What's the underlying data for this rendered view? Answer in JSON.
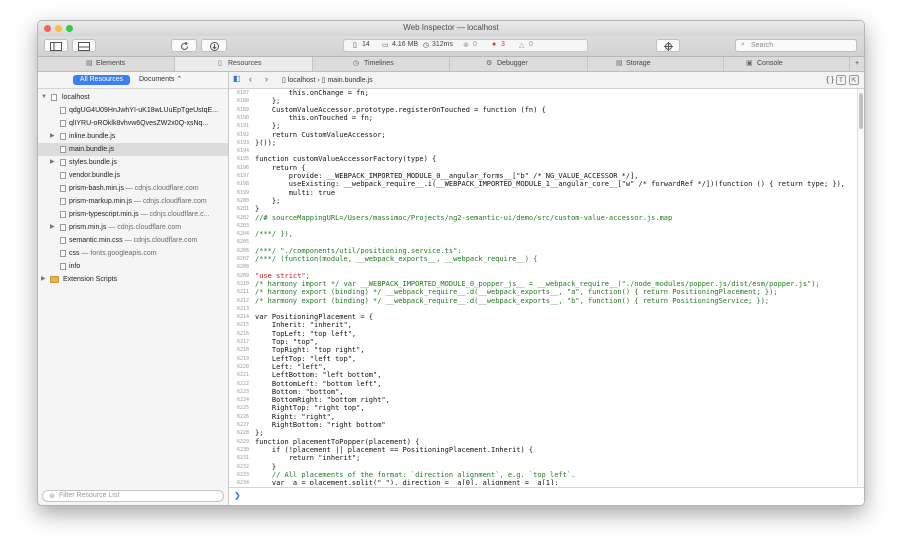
{
  "window": {
    "title": "Web Inspector — localhost",
    "traffic_lights": [
      "#fc605c",
      "#fdbc40",
      "#34c84a"
    ]
  },
  "toolbar": {
    "resource_count": "14",
    "size": "4.16 MB",
    "time": "312ms",
    "errors": "0",
    "warnings": "3",
    "logs": "0",
    "search_placeholder": "Search"
  },
  "tabs": [
    {
      "label": "Elements",
      "icon": "elements-icon"
    },
    {
      "label": "Resources",
      "icon": "resources-icon"
    },
    {
      "label": "Timelines",
      "icon": "timelines-icon"
    },
    {
      "label": "Debugger",
      "icon": "debugger-icon"
    },
    {
      "label": "Storage",
      "icon": "storage-icon"
    },
    {
      "label": "Console",
      "icon": "console-icon"
    }
  ],
  "sidebar": {
    "scope_all": "All Resources",
    "scope_docs": "Documents",
    "filter_placeholder": "Filter Resource List",
    "tree": [
      {
        "name": "localhost",
        "domain": ""
      },
      {
        "name": "qdgUG4U09HnJwhYI-uK18wLUuEpTgeUstqE...",
        "domain": ""
      },
      {
        "name": "qlIYRU-oROklk8vhvw6QvesZW2x0Q-xsNq...",
        "domain": ""
      },
      {
        "name": "inline.bundle.js",
        "domain": ""
      },
      {
        "name": "main.bundle.js",
        "domain": ""
      },
      {
        "name": "styles.bundle.js",
        "domain": ""
      },
      {
        "name": "vendor.bundle.js",
        "domain": ""
      },
      {
        "name": "prism-bash.min.js",
        "domain": "— cdnjs.cloudflare.com"
      },
      {
        "name": "prism-markup.min.js",
        "domain": "— cdnjs.cloudflare.com"
      },
      {
        "name": "prism-typescript.min.js",
        "domain": "— cdnjs.cloudflare.c..."
      },
      {
        "name": "prism.min.js",
        "domain": "— cdnjs.cloudflare.com"
      },
      {
        "name": "semantic.min.css",
        "domain": "— cdnjs.cloudflare.com"
      },
      {
        "name": "css",
        "domain": "— fonts.googleapis.com"
      },
      {
        "name": "info",
        "domain": ""
      },
      {
        "name": "Extension Scripts",
        "domain": ""
      }
    ]
  },
  "content": {
    "breadcrumb_host": "localhost",
    "breadcrumb_file": "main.bundle.js",
    "code_lines": [
      {
        "n": "6187",
        "t": "        this.onChange = fn;"
      },
      {
        "n": "6188",
        "t": "    };"
      },
      {
        "n": "6189",
        "t": "    CustomValueAccessor.prototype.registerOnTouched = function (fn) {"
      },
      {
        "n": "6190",
        "t": "        this.onTouched = fn;"
      },
      {
        "n": "6191",
        "t": "    };"
      },
      {
        "n": "6192",
        "t": "    return CustomValueAccessor;"
      },
      {
        "n": "6193",
        "t": "}());"
      },
      {
        "n": "6194",
        "t": ""
      },
      {
        "n": "6195",
        "t": "function customValueAccessorFactory(type) {"
      },
      {
        "n": "6196",
        "t": "    return {"
      },
      {
        "n": "6197",
        "t": "        provide: __WEBPACK_IMPORTED_MODULE_0__angular_forms__[\"b\" /* NG_VALUE_ACCESSOR */],"
      },
      {
        "n": "6198",
        "t": "        useExisting: __webpack_require__.i(__WEBPACK_IMPORTED_MODULE_1__angular_core__[\"w\" /* forwardRef */])(function () { return type; }),"
      },
      {
        "n": "6199",
        "t": "        multi: true"
      },
      {
        "n": "6200",
        "t": "    };"
      },
      {
        "n": "6201",
        "t": "}"
      },
      {
        "n": "6202",
        "t": "//# sourceMappingURL=/Users/massimoc/Projects/ng2-semantic-ui/demo/src/custom-value-accessor.js.map"
      },
      {
        "n": "6203",
        "t": ""
      },
      {
        "n": "6204",
        "t": "/***/ }),"
      },
      {
        "n": "6205",
        "t": ""
      },
      {
        "n": "6206",
        "t": "/***/ \"./components/util/positioning.service.ts\":"
      },
      {
        "n": "6207",
        "t": "/***/ (function(module, __webpack_exports__, __webpack_require__) {"
      },
      {
        "n": "6208",
        "t": ""
      },
      {
        "n": "6209",
        "t": "\"use strict\";"
      },
      {
        "n": "6210",
        "t": "/* harmony import */ var __WEBPACK_IMPORTED_MODULE_0_popper_js__ = __webpack_require__(\"./node_modules/popper.js/dist/esm/popper.js\");"
      },
      {
        "n": "6211",
        "t": "/* harmony export (binding) */ __webpack_require__.d(__webpack_exports__, \"a\", function() { return PositioningPlacement; });"
      },
      {
        "n": "6212",
        "t": "/* harmony export (binding) */ __webpack_require__.d(__webpack_exports__, \"b\", function() { return PositioningService; });"
      },
      {
        "n": "6213",
        "t": ""
      },
      {
        "n": "6214",
        "t": "var PositioningPlacement = {"
      },
      {
        "n": "6215",
        "t": "    Inherit: \"inherit\","
      },
      {
        "n": "6216",
        "t": "    TopLeft: \"top left\","
      },
      {
        "n": "6217",
        "t": "    Top: \"top\","
      },
      {
        "n": "6218",
        "t": "    TopRight: \"top right\","
      },
      {
        "n": "6219",
        "t": "    LeftTop: \"left top\","
      },
      {
        "n": "6220",
        "t": "    Left: \"left\","
      },
      {
        "n": "6221",
        "t": "    LeftBottom: \"left bottom\","
      },
      {
        "n": "6222",
        "t": "    BottomLeft: \"bottom left\","
      },
      {
        "n": "6223",
        "t": "    Bottom: \"bottom\","
      },
      {
        "n": "6224",
        "t": "    BottomRight: \"bottom right\","
      },
      {
        "n": "6225",
        "t": "    RightTop: \"right top\","
      },
      {
        "n": "6226",
        "t": "    Right: \"right\","
      },
      {
        "n": "6227",
        "t": "    RightBottom: \"right bottom\""
      },
      {
        "n": "6228",
        "t": "};"
      },
      {
        "n": "6229",
        "t": "function placementToPopper(placement) {"
      },
      {
        "n": "6230",
        "t": "    if (!placement || placement == PositioningPlacement.Inherit) {"
      },
      {
        "n": "6231",
        "t": "        return \"inherit\";"
      },
      {
        "n": "6232",
        "t": "    }"
      },
      {
        "n": "6233",
        "t": "    // All placements of the format: `direction alignment`, e.g. `top left`."
      },
      {
        "n": "6234",
        "t": "    var _a = placement.split(\" \"), direction = _a[0], alignment = _a[1];"
      }
    ],
    "console_prompt": "❯"
  }
}
